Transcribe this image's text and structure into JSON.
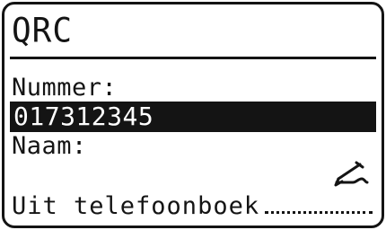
{
  "screen": {
    "title": "QRC",
    "number_label": "Nummer:",
    "number_value": "017312345",
    "name_label": "Naam:",
    "name_value": "",
    "phonebook_icon": "phonebook-pen-icon",
    "phonebook_option": "Uit telefoonboek"
  },
  "colors": {
    "foreground": "#141414",
    "background": "#ffffff",
    "highlight_text": "#ffffff"
  }
}
